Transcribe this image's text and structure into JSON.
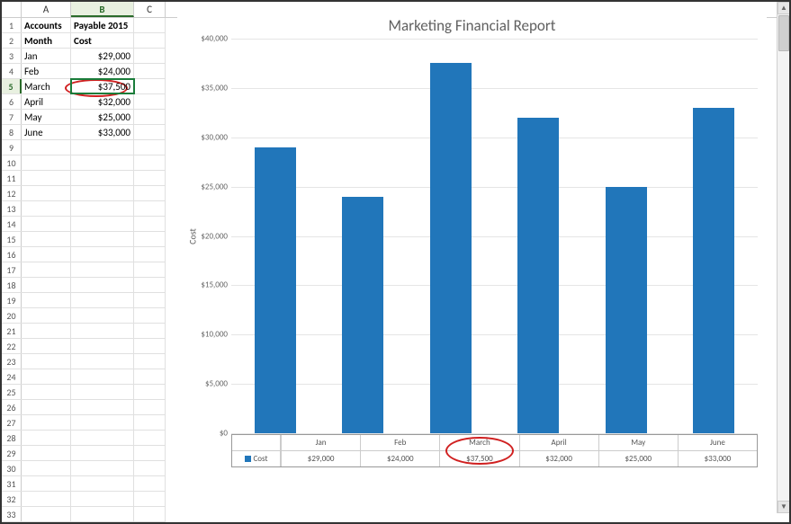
{
  "columns": [
    "A",
    "B",
    "C"
  ],
  "selected_col": "B",
  "selected_row": 5,
  "headers": {
    "A1": "Accounts",
    "B1": "Payable 2015",
    "A2": "Month",
    "B2": "Cost"
  },
  "rows": [
    {
      "r": 3,
      "month": "Jan",
      "cost": "$29,000"
    },
    {
      "r": 4,
      "month": "Feb",
      "cost": "$24,000"
    },
    {
      "r": 5,
      "month": "March",
      "cost": "$37,500"
    },
    {
      "r": 6,
      "month": "April",
      "cost": "$32,000"
    },
    {
      "r": 7,
      "month": "May",
      "cost": "$25,000"
    },
    {
      "r": 8,
      "month": "June",
      "cost": "$33,000"
    }
  ],
  "max_row": 33,
  "chart_data": {
    "type": "bar",
    "title": "Marketing Financial Report",
    "ylabel": "Cost",
    "xlabel": "",
    "categories": [
      "Jan",
      "Feb",
      "March",
      "April",
      "May",
      "June"
    ],
    "values": [
      29000,
      24000,
      37500,
      32000,
      25000,
      33000
    ],
    "value_labels": [
      "$29,000",
      "$24,000",
      "$37,500",
      "$32,000",
      "$25,000",
      "$33,000"
    ],
    "series_name": "Cost",
    "ylim": [
      0,
      40000
    ],
    "yticks": [
      0,
      5000,
      10000,
      15000,
      20000,
      25000,
      30000,
      35000,
      40000
    ],
    "ytick_labels": [
      "$0",
      "$5,000",
      "$10,000",
      "$15,000",
      "$20,000",
      "$25,000",
      "$30,000",
      "$35,000",
      "$40,000"
    ],
    "grid": true,
    "legend_position": "bottom"
  },
  "annotations": {
    "cell_circle": {
      "row": 5,
      "col": "B"
    },
    "table_circle_category": "March"
  }
}
